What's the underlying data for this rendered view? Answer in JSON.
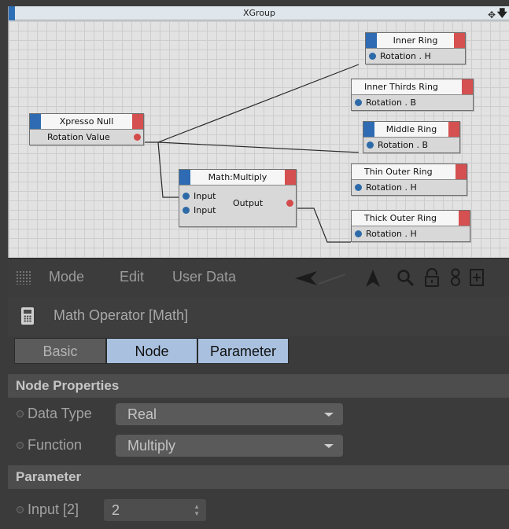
{
  "xpresso": {
    "title": "XGroup",
    "nodes": {
      "xpresso_null": {
        "title": "Xpresso Null",
        "port": "Rotation Value"
      },
      "math": {
        "title": "Math:Multiply",
        "input1": "Input",
        "input2": "Input",
        "output": "Output"
      },
      "inner_ring": {
        "title": "Inner Ring",
        "port": "Rotation . H"
      },
      "inner_thirds_ring": {
        "title": "Inner Thirds Ring",
        "port": "Rotation . B"
      },
      "middle_ring": {
        "title": "Middle Ring",
        "port": "Rotation . B"
      },
      "thin_outer_ring": {
        "title": "Thin Outer Ring",
        "port": "Rotation . H"
      },
      "thick_outer_ring": {
        "title": "Thick Outer Ring",
        "port": "Rotation . H"
      }
    }
  },
  "menubar": {
    "mode": "Mode",
    "edit": "Edit",
    "user_data": "User Data"
  },
  "object": {
    "title": "Math Operator [Math]"
  },
  "tabs": [
    {
      "label": "Basic",
      "active": false
    },
    {
      "label": "Node",
      "active": true
    },
    {
      "label": "Parameter",
      "active": true
    }
  ],
  "node_properties": {
    "header": "Node Properties",
    "data_type_label": "Data Type",
    "data_type_value": "Real",
    "function_label": "Function",
    "function_value": "Multiply"
  },
  "parameter": {
    "header": "Parameter",
    "input2_label": "Input [2]",
    "input2_value": "2"
  }
}
